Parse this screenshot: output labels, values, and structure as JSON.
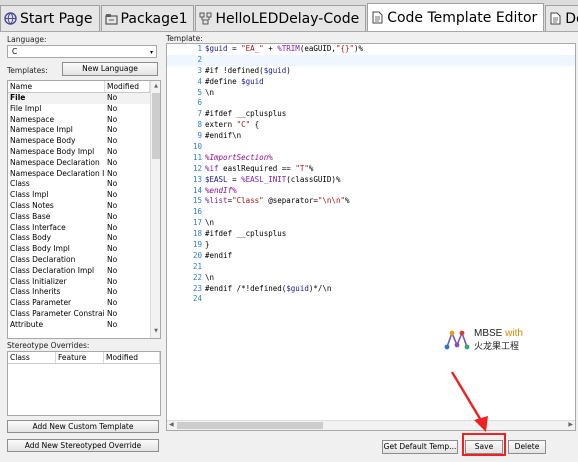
{
  "tabs": [
    {
      "label": "Start Page",
      "icon": "globe-icon",
      "active": false
    },
    {
      "label": "Package1",
      "icon": "package-icon",
      "active": false
    },
    {
      "label": "HelloLEDDelay-Code",
      "icon": "diagram-icon",
      "active": false
    },
    {
      "label": "Code Template Editor",
      "icon": "document-icon",
      "active": true
    },
    {
      "label": "Delay_loc",
      "icon": "document-icon",
      "active": false
    }
  ],
  "left": {
    "language_label": "Language:",
    "language_value": "C",
    "templates_label": "Templates:",
    "new_language_button": "New Language",
    "columns": [
      "Name",
      "Modified"
    ],
    "templates": [
      {
        "name": "File",
        "modified": "No",
        "selected": true
      },
      {
        "name": "File Impl",
        "modified": "No"
      },
      {
        "name": "Namespace",
        "modified": "No"
      },
      {
        "name": "Namespace Impl",
        "modified": "No"
      },
      {
        "name": "Namespace Body",
        "modified": "No"
      },
      {
        "name": "Namespace Body Impl",
        "modified": "No"
      },
      {
        "name": "Namespace Declaration",
        "modified": "No"
      },
      {
        "name": "Namespace Declaration Impl",
        "modified": "No"
      },
      {
        "name": "Class",
        "modified": "No"
      },
      {
        "name": "Class Impl",
        "modified": "No"
      },
      {
        "name": "Class Notes",
        "modified": "No"
      },
      {
        "name": "Class Base",
        "modified": "No"
      },
      {
        "name": "Class Interface",
        "modified": "No"
      },
      {
        "name": "Class Body",
        "modified": "No"
      },
      {
        "name": "Class Body Impl",
        "modified": "No"
      },
      {
        "name": "Class Declaration",
        "modified": "No"
      },
      {
        "name": "Class Declaration Impl",
        "modified": "No"
      },
      {
        "name": "Class Initializer",
        "modified": "No"
      },
      {
        "name": "Class Inherits",
        "modified": "No"
      },
      {
        "name": "Class Parameter",
        "modified": "No"
      },
      {
        "name": "Class Parameter Constraint",
        "modified": "No"
      },
      {
        "name": "Attribute",
        "modified": "No"
      }
    ],
    "stereotype_label": "Stereotype Overrides:",
    "stereotype_columns": [
      "Class",
      "Feature",
      "Modified"
    ],
    "add_custom_button": "Add New Custom Template",
    "add_stereotype_button": "Add New Stereotyped Override"
  },
  "editor": {
    "label": "Template:",
    "lines": [
      {
        "n": "1",
        "t": "$guid = \"EA_\" + %TRIM(eaGUID,\"{}\")%"
      },
      {
        "n": "2",
        "t": ""
      },
      {
        "n": "3",
        "t": "#if !defined($guid)"
      },
      {
        "n": "4",
        "t": "#define $guid"
      },
      {
        "n": "5",
        "t": "\\n"
      },
      {
        "n": "6",
        "t": ""
      },
      {
        "n": "7",
        "t": "#ifdef __cplusplus"
      },
      {
        "n": "8",
        "t": "extern \"C\" {"
      },
      {
        "n": "9",
        "t": "#endif\\n"
      },
      {
        "n": "10",
        "t": ""
      },
      {
        "n": "11",
        "t": "%ImportSection%"
      },
      {
        "n": "12",
        "t": "%if easlRequired == \"T\"%"
      },
      {
        "n": "13",
        "t": "$EASL = %EASL_INIT(classGUID)%"
      },
      {
        "n": "14",
        "t": "%endIf%"
      },
      {
        "n": "15",
        "t": "%list=\"Class\" @separator=\"\\n\\n\"%"
      },
      {
        "n": "16",
        "t": ""
      },
      {
        "n": "17",
        "t": "\\n"
      },
      {
        "n": "18",
        "t": "#ifdef __cplusplus"
      },
      {
        "n": "19",
        "t": "}"
      },
      {
        "n": "20",
        "t": "#endif"
      },
      {
        "n": "21",
        "t": ""
      },
      {
        "n": "22",
        "t": "\\n"
      },
      {
        "n": "23",
        "t": "#endif /*!defined($guid)*/\\n"
      },
      {
        "n": "24",
        "t": ""
      }
    ]
  },
  "footer": {
    "get_default_button": "Get Default Temp...",
    "save_button": "Save",
    "delete_button": "Delete"
  },
  "watermark": {
    "line1_a": "MBSE ",
    "line1_b": "with",
    "line2": "火龙果工程"
  },
  "colors": {
    "line_number": "#2b7fd1",
    "annotation_box": "#e22222",
    "annotation_arrow": "#e22222"
  }
}
